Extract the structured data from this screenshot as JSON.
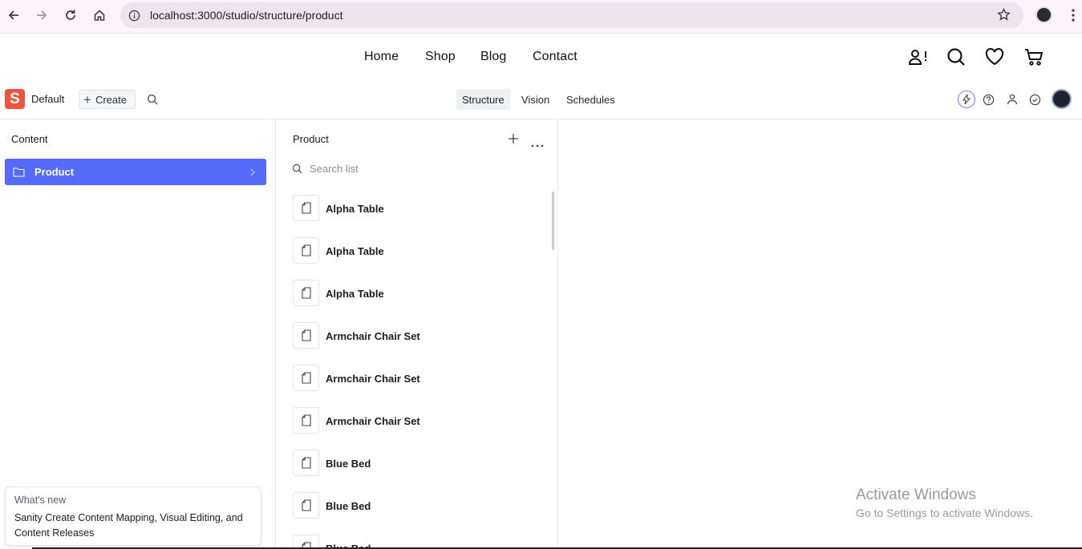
{
  "browser": {
    "url": "localhost:3000/studio/structure/product"
  },
  "site_nav": {
    "links": [
      "Home",
      "Shop",
      "Blog",
      "Contact"
    ]
  },
  "studio": {
    "logo_letter": "S",
    "workspace": "Default",
    "create_label": "Create",
    "tabs": [
      "Structure",
      "Vision",
      "Schedules"
    ],
    "active_tab": "Structure",
    "accent_color": "#556bfc",
    "logo_color": "#f0533e"
  },
  "content_pane": {
    "title": "Content",
    "items": [
      {
        "label": "Product",
        "selected": true
      }
    ]
  },
  "product_pane": {
    "title": "Product",
    "search_placeholder": "Search list",
    "items": [
      "Alpha Table",
      "Alpha Table",
      "Alpha Table",
      "Armchair Chair Set",
      "Armchair Chair Set",
      "Armchair Chair Set",
      "Blue Bed",
      "Blue Bed",
      "Blue Bed"
    ]
  },
  "whats_new": {
    "title": "What's new",
    "body": "Sanity Create Content Mapping, Visual Editing, and Content Releases"
  },
  "watermark": {
    "title": "Activate Windows",
    "subtitle": "Go to Settings to activate Windows."
  }
}
